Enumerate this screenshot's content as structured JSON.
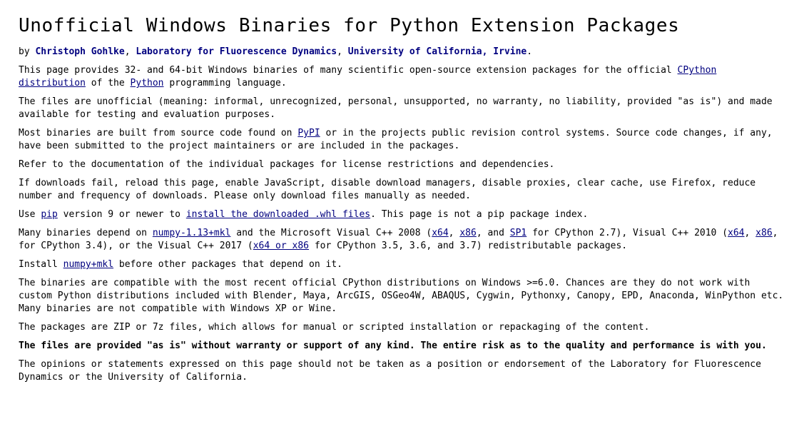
{
  "title": "Unofficial Windows Binaries for Python Extension Packages",
  "byline": {
    "prefix": "by ",
    "authors": [
      "Christoph Gohlke",
      "Laboratory for Fluorescence Dynamics",
      "University of California, Irvine"
    ],
    "sep": ", ",
    "end": "."
  },
  "p1": {
    "a": "This page provides 32- and 64-bit Windows binaries of many scientific open-source extension packages for the official ",
    "link1": "CPython distribution",
    "b": " of the ",
    "link2": "Python",
    "c": " programming language."
  },
  "p2": "The files are unofficial (meaning: informal, unrecognized, personal, unsupported, no warranty, no liability, provided \"as is\") and made available for testing and evaluation purposes.",
  "p3": {
    "a": "Most binaries are built from source code found on ",
    "link1": "PyPI",
    "b": " or in the projects public revision control systems. Source code changes, if any, have been submitted to the project maintainers or are included in the packages."
  },
  "p4": "Refer to the documentation of the individual packages for license restrictions and dependencies.",
  "p5": "If downloads fail, reload this page, enable JavaScript, disable download managers, disable proxies, clear cache, use Firefox, reduce number and frequency of downloads. Please only download files manually as needed.",
  "p6": {
    "a": "Use ",
    "link1": "pip",
    "b": " version 9 or newer to ",
    "link2": "install the downloaded .whl files",
    "c": ". This page is not a pip package index."
  },
  "p7": {
    "a": "Many binaries depend on ",
    "link_numpy": "numpy-1.13+mkl",
    "b": " and the Microsoft Visual C++ 2008 (",
    "link_x64a": "x64",
    "c": ", ",
    "link_x86a": "x86",
    "d": ", and ",
    "link_sp1": "SP1",
    "e": " for CPython 2.7), Visual C++ 2010 (",
    "link_x64b": "x64",
    "f": ", ",
    "link_x86b": "x86",
    "g": ", for CPython 3.4), or the Visual C++ 2017 (",
    "link_x64orx86": "x64 or x86",
    "h": " for CPython 3.5, 3.6, and 3.7) redistributable packages."
  },
  "p8": {
    "a": "Install ",
    "link1": "numpy+mkl",
    "b": " before other packages that depend on it."
  },
  "p9": "The binaries are compatible with the most recent official CPython distributions on Windows >=6.0. Chances are they do not work with custom Python distributions included with Blender, Maya, ArcGIS, OSGeo4W, ABAQUS, Cygwin, Pythonxy, Canopy, EPD, Anaconda, WinPython etc. Many binaries are not compatible with Windows XP or Wine.",
  "p10": "The packages are ZIP or 7z files, which allows for manual or scripted installation or repackaging of the content.",
  "p11": "The files are provided \"as is\" without warranty or support of any kind. The entire risk as to the quality and performance is with you.",
  "p12": "The opinions or statements expressed on this page should not be taken as a position or endorsement of the Laboratory for Fluorescence Dynamics or the University of California.",
  "colors": {
    "link": "#00007f",
    "author": "#000080",
    "text": "#000000",
    "background": "#ffffff"
  }
}
